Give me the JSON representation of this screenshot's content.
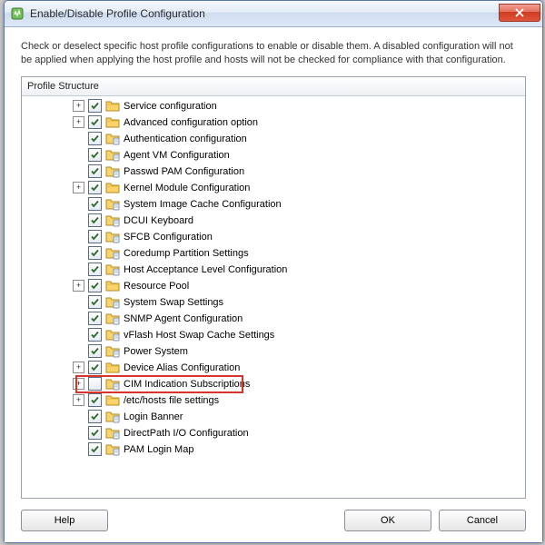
{
  "window": {
    "title": "Enable/Disable Profile Configuration"
  },
  "description": "Check or deselect specific host profile configurations to enable or disable them. A disabled configuration will not be applied when applying the host profile and hosts will not be checked for compliance with that configuration.",
  "tree": {
    "header": "Profile Structure",
    "items": [
      {
        "expandable": true,
        "checked": true,
        "icon": "folder",
        "label": "Service configuration"
      },
      {
        "expandable": true,
        "checked": true,
        "icon": "folder",
        "label": "Advanced configuration option"
      },
      {
        "expandable": false,
        "checked": true,
        "icon": "profile",
        "label": "Authentication configuration"
      },
      {
        "expandable": false,
        "checked": true,
        "icon": "profile",
        "label": "Agent VM Configuration"
      },
      {
        "expandable": false,
        "checked": true,
        "icon": "profile",
        "label": "Passwd PAM Configuration"
      },
      {
        "expandable": true,
        "checked": true,
        "icon": "folder",
        "label": "Kernel Module Configuration"
      },
      {
        "expandable": false,
        "checked": true,
        "icon": "profile",
        "label": "System Image Cache Configuration"
      },
      {
        "expandable": false,
        "checked": true,
        "icon": "profile",
        "label": "DCUI Keyboard"
      },
      {
        "expandable": false,
        "checked": true,
        "icon": "profile",
        "label": "SFCB Configuration"
      },
      {
        "expandable": false,
        "checked": true,
        "icon": "profile",
        "label": "Coredump Partition Settings"
      },
      {
        "expandable": false,
        "checked": true,
        "icon": "profile",
        "label": "Host Acceptance Level Configuration"
      },
      {
        "expandable": true,
        "checked": true,
        "icon": "folder",
        "label": "Resource Pool"
      },
      {
        "expandable": false,
        "checked": true,
        "icon": "profile",
        "label": "System Swap Settings"
      },
      {
        "expandable": false,
        "checked": true,
        "icon": "profile",
        "label": "SNMP Agent Configuration"
      },
      {
        "expandable": false,
        "checked": true,
        "icon": "profile",
        "label": "vFlash Host Swap Cache Settings"
      },
      {
        "expandable": false,
        "checked": true,
        "icon": "profile",
        "label": "Power System"
      },
      {
        "expandable": true,
        "checked": true,
        "icon": "folder",
        "label": "Device Alias Configuration"
      },
      {
        "expandable": true,
        "checked": false,
        "icon": "profile",
        "label": "CIM Indication Subscriptions",
        "highlight": true
      },
      {
        "expandable": true,
        "checked": true,
        "icon": "folder",
        "label": "/etc/hosts file settings"
      },
      {
        "expandable": false,
        "checked": true,
        "icon": "profile",
        "label": "Login Banner"
      },
      {
        "expandable": false,
        "checked": true,
        "icon": "profile",
        "label": "DirectPath I/O Configuration"
      },
      {
        "expandable": false,
        "checked": true,
        "icon": "profile",
        "label": "PAM Login Map"
      }
    ]
  },
  "buttons": {
    "help": "Help",
    "ok": "OK",
    "cancel": "Cancel"
  }
}
